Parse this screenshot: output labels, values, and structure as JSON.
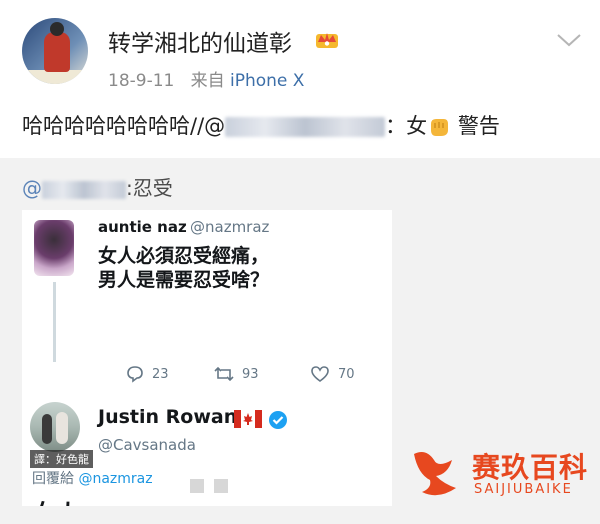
{
  "post": {
    "username": "转学湘北的仙道彰",
    "date": "18-9-11",
    "source_prefix": "来自",
    "source": "iPhone X",
    "text_start": "哈哈哈哈哈哈哈哈//@",
    "text_end": "：女",
    "text_warning": "警告"
  },
  "repost": {
    "at": "@",
    "text": ":忍受"
  },
  "tweet": {
    "author1_name": "auntie naz",
    "author1_handle": "@nazmraz",
    "body_line1": "女人必須忍受經痛，",
    "body_line2": "男人是需要忍受啥？",
    "replies": "23",
    "retweets": "93",
    "likes": "70",
    "author2_name": "Justin Rowan",
    "author2_handle": "@Cavsanada",
    "reply_prefix": "回覆給",
    "reply_handle": "@nazmraz",
    "reply_body": "女人",
    "avatar_watermark": "譯：好色龍"
  },
  "brand": {
    "name_cn": "赛玖百科",
    "name_en": "SAIJIUBAIKE",
    "color": "#e7481f"
  },
  "icons": [
    "crown-icon",
    "chevron-down-icon",
    "fist-icon",
    "reply-icon",
    "retweet-icon",
    "heart-icon",
    "mail-icon",
    "flag-icon",
    "verified-icon",
    "brand-logo-icon"
  ]
}
